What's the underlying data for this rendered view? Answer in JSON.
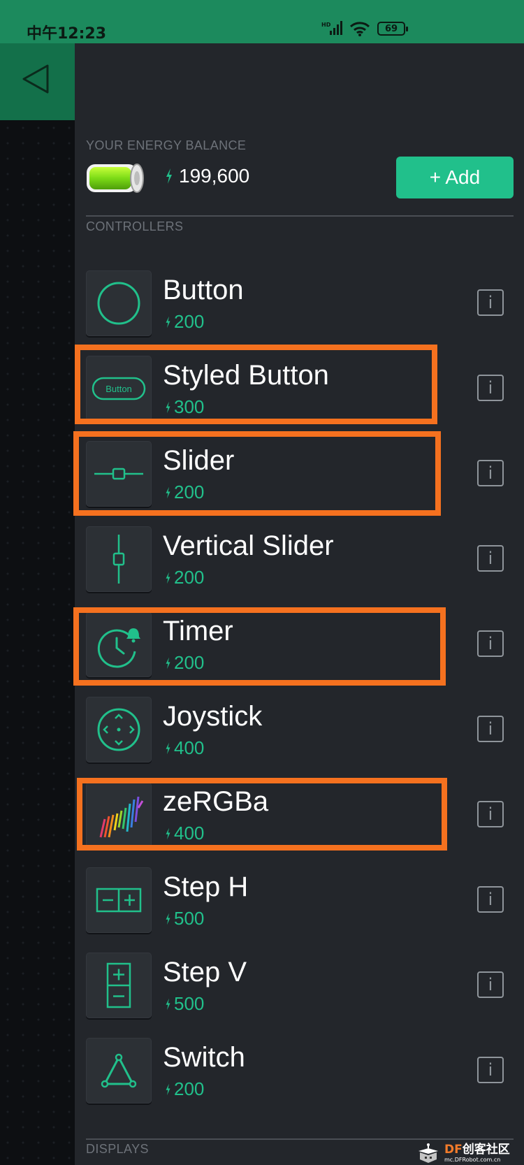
{
  "status_bar": {
    "time": "中午12:23",
    "battery_level": "69",
    "network": "HD"
  },
  "balance": {
    "label": "YOUR ENERGY BALANCE",
    "amount": "199,600",
    "add_label": "+ Add"
  },
  "sections": {
    "controllers": "CONTROLLERS",
    "displays": "DISPLAYS"
  },
  "items": [
    {
      "name": "Button",
      "price": "200",
      "icon": "circle-icon"
    },
    {
      "name": "Styled Button",
      "price": "300",
      "icon": "styled-button-icon",
      "icon_text": "Button"
    },
    {
      "name": "Slider",
      "price": "200",
      "icon": "slider-icon"
    },
    {
      "name": "Vertical Slider",
      "price": "200",
      "icon": "vertical-slider-icon"
    },
    {
      "name": "Timer",
      "price": "200",
      "icon": "timer-icon"
    },
    {
      "name": "Joystick",
      "price": "400",
      "icon": "joystick-icon"
    },
    {
      "name": "zeRGBa",
      "price": "400",
      "icon": "zebra-icon"
    },
    {
      "name": "Step H",
      "price": "500",
      "icon": "step-h-icon"
    },
    {
      "name": "Step V",
      "price": "500",
      "icon": "step-v-icon"
    },
    {
      "name": "Switch",
      "price": "200",
      "icon": "switch-icon"
    }
  ],
  "info_glyph": "i",
  "watermark": {
    "df": "DF",
    "title": "创客社区",
    "url": "mc.DFRobot.com.cn"
  },
  "colors": {
    "accent": "#21c08b",
    "status_bar": "#1c8a5d",
    "highlight": "#f5711f",
    "drawer_bg": "#23262b"
  }
}
